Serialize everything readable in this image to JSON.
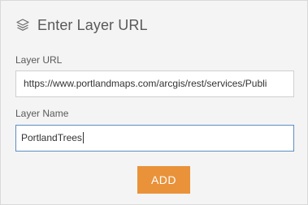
{
  "header": {
    "title": "Enter Layer URL",
    "icon": "layers-icon"
  },
  "form": {
    "url_label": "Layer URL",
    "url_value": "https://www.portlandmaps.com/arcgis/rest/services/Publi",
    "name_label": "Layer Name",
    "name_value": "PortlandTrees"
  },
  "actions": {
    "add_label": "ADD"
  },
  "colors": {
    "accent": "#e9923a",
    "focus_border": "#5b8ec4",
    "panel_bg": "#f4f4f4"
  }
}
